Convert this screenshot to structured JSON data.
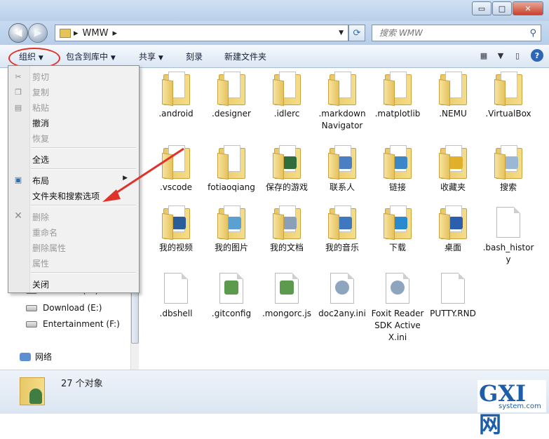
{
  "window": {
    "controls": {
      "minimize": "▭",
      "maximize": "□",
      "close": "✕"
    }
  },
  "address": {
    "path_root": "▸",
    "path_current": "WMW",
    "path_sep": "▸"
  },
  "search": {
    "placeholder": "搜索 WMW"
  },
  "toolbar": {
    "organize": "组织",
    "include_library": "包含到库中",
    "share": "共享",
    "burn": "刻录",
    "new_folder": "新建文件夹"
  },
  "menu": {
    "cut": "剪切",
    "copy": "复制",
    "paste": "粘贴",
    "undo": "撤消",
    "redo": "恢复",
    "select_all": "全选",
    "layout": "布局",
    "folder_options": "文件夹和搜索选项",
    "delete": "删除",
    "rename": "重命名",
    "remove_props": "删除属性",
    "properties": "属性",
    "close": "关闭"
  },
  "nav": {
    "software": "Software (D:)",
    "download": "Download (E:)",
    "entertainment": "Entertainment (F:)",
    "network": "网络"
  },
  "files": [
    {
      "label": ".android",
      "kind": "folder"
    },
    {
      "label": ".designer",
      "kind": "folder"
    },
    {
      "label": ".idlerc",
      "kind": "folder"
    },
    {
      "label": ".markdownNavigator",
      "kind": "folder"
    },
    {
      "label": ".matplotlib",
      "kind": "folder"
    },
    {
      "label": ".NEMU",
      "kind": "folder"
    },
    {
      "label": ".VirtualBox",
      "kind": "folder"
    },
    {
      "label": ".vscode",
      "kind": "folder"
    },
    {
      "label": "fotiaoqiang",
      "kind": "folder"
    },
    {
      "label": "保存的游戏",
      "kind": "folder"
    },
    {
      "label": "联系人",
      "kind": "folder"
    },
    {
      "label": "链接",
      "kind": "folder"
    },
    {
      "label": "收藏夹",
      "kind": "folder"
    },
    {
      "label": "搜索",
      "kind": "folder"
    },
    {
      "label": "我的视频",
      "kind": "folder"
    },
    {
      "label": "我的图片",
      "kind": "folder"
    },
    {
      "label": "我的文档",
      "kind": "folder"
    },
    {
      "label": "我的音乐",
      "kind": "folder"
    },
    {
      "label": "下载",
      "kind": "folder"
    },
    {
      "label": "桌面",
      "kind": "folder"
    },
    {
      "label": ".bash_history",
      "kind": "file"
    },
    {
      "label": ".dbshell",
      "kind": "file"
    },
    {
      "label": ".gitconfig",
      "kind": "file"
    },
    {
      "label": ".mongorc.js",
      "kind": "file"
    },
    {
      "label": "doc2any.ini",
      "kind": "file"
    },
    {
      "label": "Foxit Reader SDK ActiveX.ini",
      "kind": "file"
    },
    {
      "label": "PUTTY.RND",
      "kind": "file"
    }
  ],
  "status": {
    "count": "27 个对象"
  },
  "watermark": {
    "brand": "GXI网",
    "domain": "system.com"
  }
}
